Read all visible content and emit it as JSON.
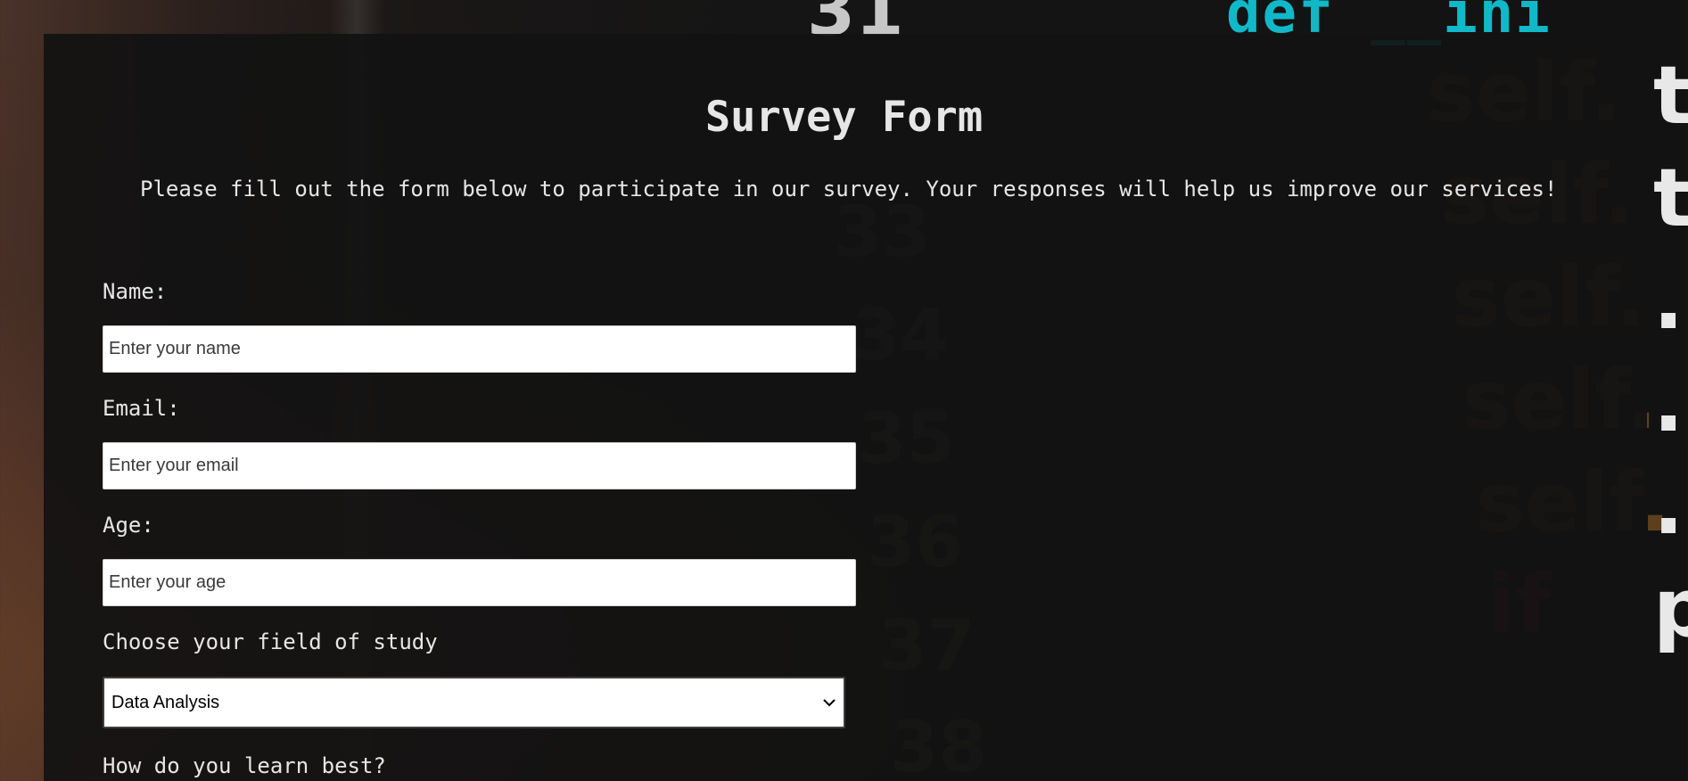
{
  "form": {
    "title": "Survey Form",
    "description": "Please fill out the form below to participate in our survey. Your responses will help us improve our services!",
    "name": {
      "label": "Name:",
      "placeholder": "Enter your name"
    },
    "email": {
      "label": "Email:",
      "placeholder": "Enter your email"
    },
    "age": {
      "label": "Age:",
      "placeholder": "Enter your age"
    },
    "field_of_study": {
      "label": "Choose your field of study",
      "selected": "Data Analysis"
    },
    "learn_best": {
      "label": "How do you learn best?"
    }
  },
  "icons": {
    "select_chevron": "chevron-down-icon"
  }
}
